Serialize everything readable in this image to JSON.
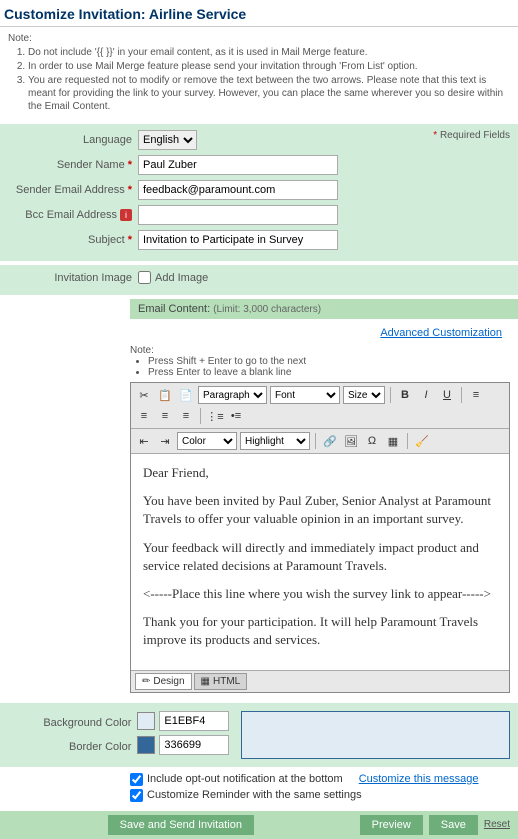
{
  "page_title": "Customize Invitation: Airline Service",
  "notes": {
    "label": "Note:",
    "items": [
      "Do not include '{{ }}' in your email content, as it is used in Mail Merge feature.",
      "In order to use Mail Merge feature please send your invitation through 'From List' option.",
      "You are requested not to modify or remove the text between the two arrows. Please note that this text is meant for providing the link to your survey. However, you can place the same wherever you so desire within the Email Content."
    ]
  },
  "required_label": "Required Fields",
  "form": {
    "language": {
      "label": "Language",
      "value": "English"
    },
    "sender_name": {
      "label": "Sender Name",
      "value": "Paul Zuber"
    },
    "sender_email": {
      "label": "Sender Email Address",
      "value": "feedback@paramount.com"
    },
    "bcc": {
      "label": "Bcc Email Address",
      "value": ""
    },
    "subject": {
      "label": "Subject",
      "value": "Invitation to Participate in Survey"
    }
  },
  "invitation_image": {
    "label": "Invitation Image",
    "checkbox_label": "Add Image"
  },
  "email_content": {
    "header": "Email Content:",
    "limit": "(Limit: 3,000 characters)",
    "advanced_link": "Advanced Customization",
    "note_label": "Note:",
    "note_items": [
      "Press Shift + Enter to go to the next",
      "Press Enter to leave a blank line"
    ],
    "toolbar": {
      "paragraph": "Paragraph",
      "font": "Font",
      "size": "Size",
      "color": "Color",
      "highlight": "Highlight"
    },
    "body": {
      "p1": "Dear Friend,",
      "p2": "You have been invited by Paul Zuber, Senior Analyst at Paramount Travels to offer your valuable opinion in an important survey.",
      "p3": "Your feedback will directly and immediately impact product and service related decisions at Paramount Travels.",
      "p4": "<-----Place this line where you wish the survey link to appear----->",
      "p5": "Thank you for your participation. It will help Paramount Travels improve its products and services."
    },
    "tabs": {
      "design": "Design",
      "html": "HTML"
    }
  },
  "colors": {
    "bg_label": "Background Color",
    "bg_value": "E1EBF4",
    "border_label": "Border Color",
    "border_value": "336699"
  },
  "options": {
    "optout": "Include opt-out notification at the bottom",
    "optout_link": "Customize this message",
    "reminder": "Customize Reminder with the same settings"
  },
  "buttons": {
    "main": "Save and Send Invitation",
    "preview": "Preview",
    "save": "Save",
    "reset": "Reset"
  }
}
